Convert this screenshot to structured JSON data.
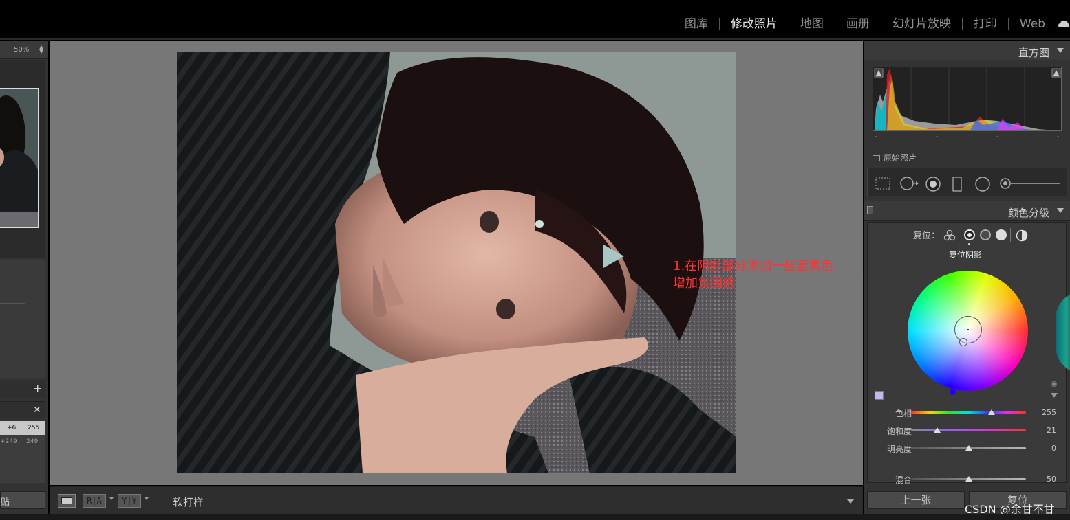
{
  "modules": [
    "图库",
    "修改照片",
    "地图",
    "画册",
    "幻灯片放映",
    "打印",
    "Web"
  ],
  "active_module": "修改照片",
  "left_panel": {
    "zoom_value": "50%",
    "history_rows": [
      {
        "a": "+6",
        "b": "255",
        "selected": true
      },
      {
        "a": "+249",
        "b": "249",
        "selected": false
      }
    ],
    "copy_button_label": "贴"
  },
  "annotation": {
    "line1": "1.在阴影部分添加一些蓝紫色",
    "line2": "增加氛围感",
    "color": "#ff3333"
  },
  "toolbar": {
    "ra_label": "R|A",
    "yy_label": "Y|Y",
    "softproof_label": "软打样",
    "softproof_checked": false
  },
  "right_panel": {
    "histogram_title": "直方图",
    "original_photo_label": "原始照片",
    "histogram_ticks": [
      "-",
      "-",
      "-",
      "-"
    ],
    "split_toning_title": "颜色分级",
    "reset_label": "复位：",
    "tooltip": "复位阴影",
    "swatch_color": "#c7b4f6",
    "sliders": [
      {
        "label": "色相",
        "value": "255",
        "position": 0.7,
        "track": "hue"
      },
      {
        "label": "饱和度",
        "value": "21",
        "position": 0.23,
        "track": "hue"
      },
      {
        "label": "明亮度",
        "value": "0",
        "position": 0.5,
        "track": "gray"
      },
      {
        "label": "混合",
        "value": "50",
        "position": 0.5,
        "track": "gray"
      }
    ],
    "prev_button": "上一张",
    "reset_button": "复位"
  },
  "watermark": "CSDN @余甘不甘"
}
